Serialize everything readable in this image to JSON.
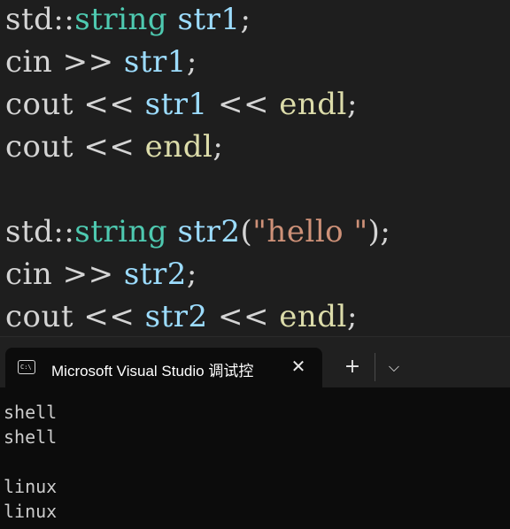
{
  "colors": {
    "editor_bg": "#1e1e1e",
    "plain": "#d4d4d4",
    "type": "#4ec9b0",
    "variable": "#9cdcfe",
    "function": "#dcdcaa",
    "string": "#ce9178",
    "console_bg": "#0c0c0c",
    "console_text": "#cccccc"
  },
  "editor": {
    "lines": [
      {
        "tokens": [
          {
            "t": "std::",
            "c": "plain"
          },
          {
            "t": "string",
            "c": "type"
          },
          {
            "t": " ",
            "c": "plain"
          },
          {
            "t": "str1",
            "c": "variable"
          },
          {
            "t": ";",
            "c": "plain"
          }
        ]
      },
      {
        "tokens": [
          {
            "t": "cin >> ",
            "c": "plain"
          },
          {
            "t": "str1",
            "c": "variable"
          },
          {
            "t": ";",
            "c": "plain"
          }
        ]
      },
      {
        "tokens": [
          {
            "t": "cout << ",
            "c": "plain"
          },
          {
            "t": "str1",
            "c": "variable"
          },
          {
            "t": " << ",
            "c": "plain"
          },
          {
            "t": "endl",
            "c": "function"
          },
          {
            "t": ";",
            "c": "plain"
          }
        ]
      },
      {
        "tokens": [
          {
            "t": "cout << ",
            "c": "plain"
          },
          {
            "t": "endl",
            "c": "function"
          },
          {
            "t": ";",
            "c": "plain"
          }
        ]
      },
      {
        "tokens": []
      },
      {
        "tokens": [
          {
            "t": "std::",
            "c": "plain"
          },
          {
            "t": "string",
            "c": "type"
          },
          {
            "t": " ",
            "c": "plain"
          },
          {
            "t": "str2",
            "c": "variable"
          },
          {
            "t": "(",
            "c": "plain"
          },
          {
            "t": "\"hello \"",
            "c": "string"
          },
          {
            "t": ");",
            "c": "plain"
          }
        ]
      },
      {
        "tokens": [
          {
            "t": "cin >> ",
            "c": "plain"
          },
          {
            "t": "str2",
            "c": "variable"
          },
          {
            "t": ";",
            "c": "plain"
          }
        ]
      },
      {
        "tokens": [
          {
            "t": "cout << ",
            "c": "plain"
          },
          {
            "t": "str2",
            "c": "variable"
          },
          {
            "t": " << ",
            "c": "plain"
          },
          {
            "t": "endl",
            "c": "function"
          },
          {
            "t": ";",
            "c": "plain"
          }
        ]
      }
    ]
  },
  "terminal": {
    "tab": {
      "icon": "console-icon",
      "icon_glyph": "C:\\",
      "title": "Microsoft Visual Studio 调试控",
      "close_icon": "close-icon",
      "close_glyph": "✕"
    },
    "new_tab": {
      "icon": "plus-icon",
      "glyph": "+"
    },
    "dropdown": {
      "icon": "chevron-down-icon",
      "glyph": "⌵"
    },
    "output": [
      "shell",
      "shell",
      "",
      "linux",
      "linux"
    ]
  }
}
